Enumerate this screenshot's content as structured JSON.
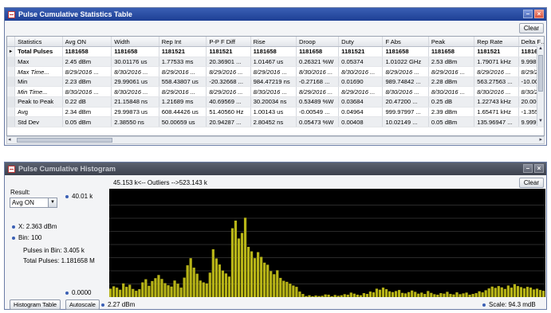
{
  "table_window": {
    "title": "Pulse Cumulative Statistics Table",
    "clear_label": "Clear",
    "columns": [
      "Statistics",
      "Avg ON",
      "Width",
      "Rep Int",
      "P-P F Diff",
      "Rise",
      "Droop",
      "Duty",
      "F Abs",
      "Peak",
      "Rep Rate",
      "Delta Freq"
    ],
    "rows": [
      {
        "marker": "▸",
        "style": "bold",
        "cells": [
          "Total Pulses",
          "1181658",
          "1181658",
          "1181521",
          "1181521",
          "1181658",
          "1181658",
          "1181521",
          "1181658",
          "1181658",
          "1181521",
          "1181658"
        ]
      },
      {
        "marker": "",
        "style": "",
        "cells": [
          "Max",
          "2.45 dBm",
          "30.01176 us",
          "1.77533 ms",
          "20.36901 ...",
          "1.01467 us",
          "0.26321 %W",
          "0.05374",
          "1.01022 GHz",
          "2.53 dBm",
          "1.79071 kHz",
          "9.99894..."
        ]
      },
      {
        "marker": "",
        "style": "ital",
        "cells": [
          "Max Time...",
          "8/29/2016 ...",
          "8/30/2016 ...",
          "8/29/2016 ...",
          "8/29/2016 ...",
          "8/29/2016 ...",
          "8/30/2016 ...",
          "8/30/2016 ...",
          "8/29/2016 ...",
          "8/29/2016 ...",
          "8/29/2016 ...",
          "8/29/2016..."
        ]
      },
      {
        "marker": "",
        "style": "",
        "cells": [
          "Min",
          "2.23 dBm",
          "29.99061 us",
          "558.43807 us",
          "-20.32668 ...",
          "984.47219 ns",
          "-0.27168 ...",
          "0.01690",
          "989.74842 ...",
          "2.28 dBm",
          "563.27563 ...",
          "-10.0018..."
        ]
      },
      {
        "marker": "",
        "style": "ital",
        "cells": [
          "Min Time...",
          "8/30/2016 ...",
          "8/30/2016 ...",
          "8/29/2016 ...",
          "8/29/2016 ...",
          "8/30/2016 ...",
          "8/29/2016 ...",
          "8/29/2016 ...",
          "8/30/2016 ...",
          "8/30/2016 ...",
          "8/30/2016 ...",
          "8/30/2016..."
        ]
      },
      {
        "marker": "",
        "style": "",
        "cells": [
          "Peak to Peak",
          "0.22 dB",
          "21.15848 ns",
          "1.21689 ms",
          "40.69569 ...",
          "30.20034 ns",
          "0.53489 %W",
          "0.03684",
          "20.47200 ...",
          "0.25 dB",
          "1.22743 kHz",
          "20.0001..."
        ]
      },
      {
        "marker": "",
        "style": "",
        "cells": [
          "Avg",
          "2.34 dBm",
          "29.99873 us",
          "608.44426 us",
          "51.40560 Hz",
          "1.00143 us",
          "-0.00549 ...",
          "0.04964",
          "999.97997 ...",
          "2.39 dBm",
          "1.65471 kHz",
          "-1.3556..."
        ]
      },
      {
        "marker": "",
        "style": "",
        "cells": [
          "Std Dev",
          "0.05 dBm",
          "2.38550 ns",
          "50.00659 us",
          "20.94287 ...",
          "2.80452 ns",
          "0.05473 %W",
          "0.00408",
          "10.02149 ...",
          "0.05 dBm",
          "135.96947 ...",
          "9.99996..."
        ]
      }
    ]
  },
  "histogram_window": {
    "title": "Pulse Cumulative Histogram",
    "clear_label": "Clear",
    "outliers": "45.153 k<--  Outliers  -->523.143 k",
    "result_label": "Result:",
    "result_value": "Avg ON",
    "y_max": "40.01 k",
    "y_min": "0.0000",
    "x_label": "X:  2.363 dBm",
    "bin_label": "Bin:  100",
    "pulses_in_bin": "Pulses in Bin: 3.405 k",
    "total_pulses": "Total Pulses: 1.181658 M",
    "histogram_table_label": "Histogram Table",
    "autoscale_label": "Autoscale",
    "x_start": "2.27 dBm",
    "scale": "Scale:    94.3 mdB",
    "bar_color": "#b7b417",
    "plot_background": "#000000"
  },
  "chart_data": {
    "type": "bar",
    "title": "",
    "xlabel": "",
    "ylabel": "",
    "ylim": [
      0,
      40010
    ],
    "values": [
      3200,
      4100,
      3600,
      2800,
      5200,
      3900,
      4700,
      3100,
      2400,
      3000,
      5600,
      6800,
      4300,
      6100,
      7200,
      8400,
      6900,
      5300,
      4500,
      4000,
      6300,
      5100,
      3600,
      7400,
      12100,
      14800,
      11200,
      8900,
      6300,
      5600,
      5200,
      9300,
      18200,
      14700,
      12400,
      10100,
      9000,
      7800,
      26200,
      29100,
      22300,
      24400,
      30200,
      19100,
      17400,
      14800,
      17100,
      15300,
      13100,
      12300,
      9900,
      8700,
      10200,
      7300,
      6200,
      5800,
      5100,
      4400,
      3900,
      2100,
      1200,
      400,
      700,
      300,
      600,
      400,
      500,
      1000,
      900,
      300,
      800,
      500,
      700,
      1100,
      900,
      1700,
      1300,
      900,
      700,
      1500,
      1200,
      2100,
      1800,
      3200,
      2800,
      3600,
      3000,
      2200,
      1900,
      2300,
      2700,
      1600,
      1400,
      1900,
      2500,
      2000,
      1300,
      1700,
      1200,
      2300,
      1600,
      1100,
      900,
      1500,
      1300,
      2000,
      1200,
      1000,
      1800,
      1100,
      1400,
      1700,
      900,
      1200,
      1500,
      2200,
      1800,
      2600,
      3300,
      4000,
      3500,
      4200,
      3700,
      3100,
      4400,
      3600,
      4900,
      4200,
      3800,
      3300,
      3900,
      3600,
      2900,
      3200,
      2700,
      2400
    ]
  }
}
